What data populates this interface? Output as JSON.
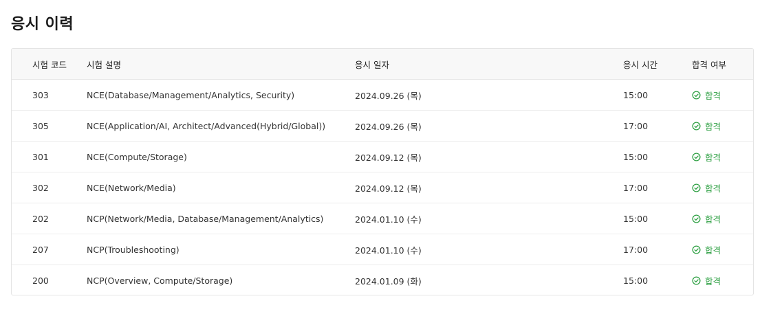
{
  "title": "응시 이력",
  "headers": {
    "code": "시험 코드",
    "desc": "시험 설명",
    "date": "응시 일자",
    "time": "응시 시간",
    "result": "합격 여부"
  },
  "rows": [
    {
      "code": "303",
      "desc": "NCE(Database/Management/Analytics, Security)",
      "date": "2024.09.26 (목)",
      "time": "15:00",
      "result": "합격"
    },
    {
      "code": "305",
      "desc": "NCE(Application/AI, Architect/Advanced(Hybrid/Global))",
      "date": "2024.09.26 (목)",
      "time": "17:00",
      "result": "합격"
    },
    {
      "code": "301",
      "desc": "NCE(Compute/Storage)",
      "date": "2024.09.12 (목)",
      "time": "15:00",
      "result": "합격"
    },
    {
      "code": "302",
      "desc": "NCE(Network/Media)",
      "date": "2024.09.12 (목)",
      "time": "17:00",
      "result": "합격"
    },
    {
      "code": "202",
      "desc": "NCP(Network/Media, Database/Management/Analytics)",
      "date": "2024.01.10 (수)",
      "time": "15:00",
      "result": "합격"
    },
    {
      "code": "207",
      "desc": "NCP(Troubleshooting)",
      "date": "2024.01.10 (수)",
      "time": "17:00",
      "result": "합격"
    },
    {
      "code": "200",
      "desc": "NCP(Overview, Compute/Storage)",
      "date": "2024.01.09 (화)",
      "time": "15:00",
      "result": "합격"
    }
  ],
  "colors": {
    "pass": "#2ea043",
    "header_bg": "#f8f8f8",
    "border": "#e4e4e4"
  },
  "icons": {
    "pass": "check-circle-icon"
  }
}
